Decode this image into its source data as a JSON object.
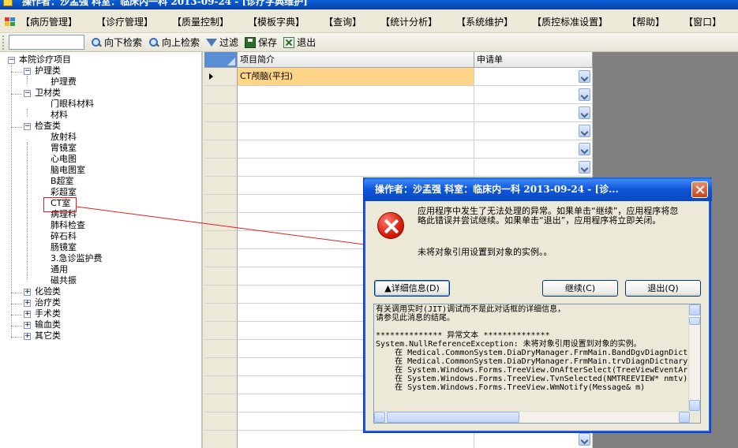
{
  "window": {
    "title": "操作者：沙孟强    科室：临床内一科    2013-09-24 - [诊疗字典维护]"
  },
  "menu": [
    "【病历管理】",
    "【诊疗管理】",
    "【质量控制】",
    "【模板字典】",
    "【查询】",
    "【统计分析】",
    "【系统维护】",
    "【质控标准设置】",
    "【帮助】",
    "【窗口】"
  ],
  "toolbar": {
    "search_value": "",
    "down": "向下检索",
    "up": "向上检索",
    "filter": "过滤",
    "save": "保存",
    "exit": "退出"
  },
  "tree": {
    "root": "本院诊疗项目",
    "nodes": {
      "nursing": "护理类",
      "nursing_fee": "护理费",
      "sanitary": "卫材类",
      "eye_material": "门眼科材料",
      "material": "材料",
      "exam": "检查类",
      "radiology": "放射科",
      "gastro": "胃镜室",
      "ecg": "心电图",
      "eeg": "脑电图室",
      "bscan": "B超室",
      "color_us": "彩超室",
      "ct": "CT室",
      "pathology": "病理科",
      "lung": "肺科检查",
      "lithotripsy": "碎石科",
      "intestine": "肠镜室",
      "emergency": "3.急诊监护费",
      "general": "通用",
      "mri": "磁共振",
      "lab": "化验类",
      "treatment": "治疗类",
      "surgery": "手术类",
      "transfusion": "输血类",
      "other": "其它类"
    }
  },
  "grid": {
    "columns": [
      "项目简介",
      "申请单"
    ],
    "rows": [
      {
        "name": "CT颅脑(平扫)",
        "form": ""
      },
      {
        "name": "",
        "form": ""
      },
      {
        "name": "",
        "form": ""
      },
      {
        "name": "",
        "form": ""
      },
      {
        "name": "",
        "form": ""
      },
      {
        "name": "",
        "form": ""
      },
      {
        "name": "",
        "form": ""
      },
      {
        "name": "",
        "form": ""
      },
      {
        "name": "",
        "form": ""
      },
      {
        "name": "",
        "form": ""
      },
      {
        "name": "",
        "form": ""
      },
      {
        "name": "",
        "form": ""
      },
      {
        "name": "",
        "form": ""
      },
      {
        "name": "",
        "form": ""
      },
      {
        "name": "",
        "form": ""
      },
      {
        "name": "",
        "form": ""
      },
      {
        "name": "",
        "form": ""
      },
      {
        "name": "",
        "form": ""
      },
      {
        "name": "",
        "form": ""
      },
      {
        "name": "",
        "form": ""
      },
      {
        "name": "",
        "form": ""
      },
      {
        "name": "",
        "form": ""
      }
    ]
  },
  "dialog": {
    "title": "操作者：沙孟强    科室：临床内一科    2013-09-24 - [诊...",
    "message": "应用程序中发生了无法处理的异常。如果单击“继续”，应用程序将忽略此错误并尝试继续。如果单击“退出”，应用程序将立即关闭。",
    "detail_message": "未将对象引用设置到对象的实例。。",
    "details_button": "▲详细信息(D)",
    "continue_button": "继续(C)",
    "quit_button": "退出(Q)",
    "details_text": "有关调用实时(JIT)调试而不是此对话框的详细信息，\n请参见此消息的结尾。\n\n************** 异常文本 **************\nSystem.NullReferenceException: 未将对象引用设置到对象的实例。\n    在 Medical.CommonSystem.DiaDryManager.FrmMain.BandDgvDiagnDictn\n    在 Medical.CommonSystem.DiaDryManager.FrmMain.trvDiagnDictnary_\n    在 System.Windows.Forms.TreeView.OnAfterSelect(TreeViewEventArg\n    在 System.Windows.Forms.TreeView.TvnSelected(NMTREEVIEW* nmtv)\n    在 System.Windows.Forms.TreeView.WmNotify(Message& m)"
  },
  "colors": {
    "selected_row": "#ffd58a",
    "annotation": "#e02020",
    "title_blue": "#0a5fd8"
  },
  "icons": {
    "search": "search-icon",
    "filter": "filter-icon",
    "save": "save-icon",
    "exit": "exit-icon",
    "error": "error-icon",
    "close": "close-icon"
  }
}
